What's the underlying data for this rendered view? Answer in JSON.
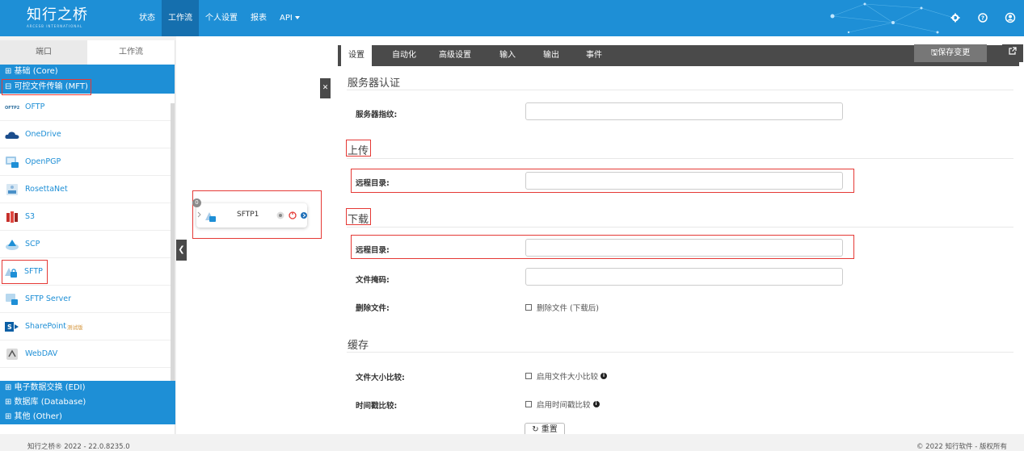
{
  "app": {
    "logo_title": "知行之桥",
    "logo_sub": "ARCESB INTERNATIONAL"
  },
  "nav": {
    "items": [
      "状态",
      "工作流",
      "个人设置",
      "报表",
      "API"
    ],
    "active": "工作流"
  },
  "colors": {
    "brand": "#1e8fd6",
    "brand_dark": "#156fae",
    "highlight": "#e53935",
    "dark_bar": "#4a4a4a"
  },
  "left_panel": {
    "tabs": [
      "端口",
      "工作流"
    ],
    "categories_top": [
      "⊞ 基础 (Core)",
      "⊟ 可控文件传输 (MFT)"
    ],
    "connectors": [
      {
        "label": "OFTP",
        "icon": "oftp-icon"
      },
      {
        "label": "OneDrive",
        "icon": "cloud-icon"
      },
      {
        "label": "OpenPGP",
        "icon": "pgp-icon"
      },
      {
        "label": "RosettaNet",
        "icon": "rosettanet-icon"
      },
      {
        "label": "S3",
        "icon": "s3-icon"
      },
      {
        "label": "SCP",
        "icon": "scp-icon"
      },
      {
        "label": "SFTP",
        "icon": "sftp-icon"
      },
      {
        "label": "SFTP Server",
        "icon": "sftp-server-icon"
      },
      {
        "label": "SharePoint",
        "icon": "sharepoint-icon",
        "badge": "测试版"
      },
      {
        "label": "WebDAV",
        "icon": "webdav-icon"
      }
    ],
    "categories_bottom": [
      "⊞ 电子数据交换 (EDI)",
      "⊞ 数据库 (Database)",
      "⊞ 其他 (Other)"
    ]
  },
  "canvas": {
    "node_label": "SFTP1",
    "node_badge": "0"
  },
  "right_panel": {
    "tabs": [
      "设置",
      "自动化",
      "高级设置",
      "输入",
      "输出",
      "事件"
    ],
    "save_label": "🖫保存变更",
    "sections": {
      "auth": "服务器认证",
      "upload": "上传",
      "download": "下载",
      "cache": "缓存"
    },
    "fields": {
      "fingerprint": "服务器指纹:",
      "upload_dir": "远程目录:",
      "download_dir": "远程目录:",
      "file_mask": "文件掩码:",
      "delete_file": "删除文件:",
      "delete_file_cb": "删除文件 (下载后)",
      "size_compare": "文件大小比较:",
      "size_compare_cb": "启用文件大小比较",
      "time_compare": "时间戳比较:",
      "time_compare_cb": "启用时间戳比较"
    },
    "reset_label": "↻ 重置"
  },
  "footer": {
    "left": "知行之桥® 2022 - 22.0.8235.0",
    "right": "© 2022 知行软件 - 版权所有"
  }
}
